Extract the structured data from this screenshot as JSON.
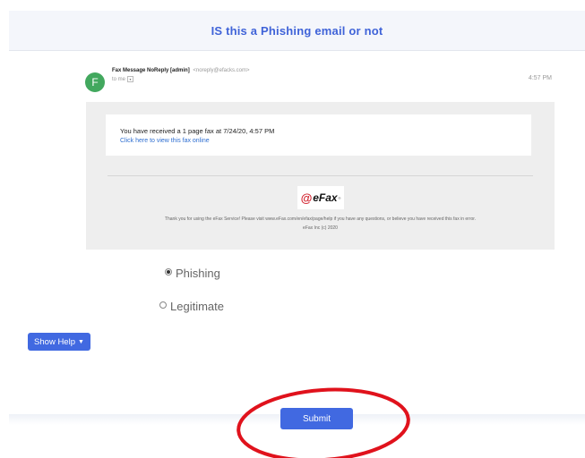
{
  "header": {
    "title": "IS this a Phishing email or not"
  },
  "email": {
    "avatar_letter": "F",
    "sender_name": "Fax Message NoReply [admin]",
    "sender_email": "<noreply@efacks.com>",
    "to_label": "to me",
    "time": "4:57 PM",
    "fax_line": "You have received a 1 page fax at 7/24/20, 4:57 PM",
    "fax_link": "Click here to view this fax online",
    "logo_text": "eFax",
    "logo_tm": "®",
    "footer_note": "Thank you for using the eFax Service! Please visit www.eFax.com/en/efax/page/help if you have any questions, or believe you have received this fax in error.",
    "copyright": "eFax Inc (c) 2020"
  },
  "options": {
    "phishing_label": "Phishing",
    "legitimate_label": "Legitimate",
    "selected": "phishing"
  },
  "buttons": {
    "show_help": "Show Help",
    "submit": "Submit"
  },
  "colors": {
    "accent": "#4169e1",
    "title": "#3f63d8",
    "annotation": "#e0121c",
    "avatar": "#42a85e"
  }
}
